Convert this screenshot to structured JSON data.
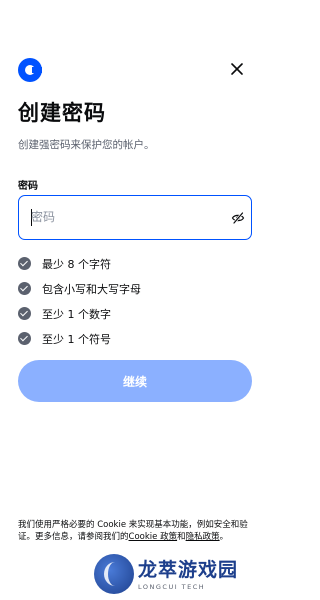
{
  "brand": {
    "logo_icon": "coinbase-logo-icon",
    "accent": "#0052ff"
  },
  "header": {
    "close_icon": "close-icon"
  },
  "title": "创建密码",
  "subtitle": "创建强密码来保护您的帐户。",
  "password": {
    "label": "密码",
    "placeholder": "密码",
    "value": "",
    "toggle_icon": "eye-slash-icon"
  },
  "requirements": [
    {
      "text": "最少 8 个字符",
      "icon": "check-circle-icon"
    },
    {
      "text": "包含小写和大写字母",
      "icon": "check-circle-icon"
    },
    {
      "text": "至少 1 个数字",
      "icon": "check-circle-icon"
    },
    {
      "text": "至少 1 个符号",
      "icon": "check-circle-icon"
    }
  ],
  "continue_button": {
    "label": "继续",
    "disabled_color": "#8bb0ff"
  },
  "footer": {
    "text_before": "我们使用严格必要的 Cookie 来实现基本功能，例如安全和验证。更多信息，请参阅我们的",
    "cookie_link": "Cookie 政策",
    "text_middle": "和",
    "privacy_link": "隐私政策",
    "text_after": "。"
  },
  "watermark": {
    "title": "龙萃游戏园",
    "subtitle": "LONGCUI TECH"
  }
}
